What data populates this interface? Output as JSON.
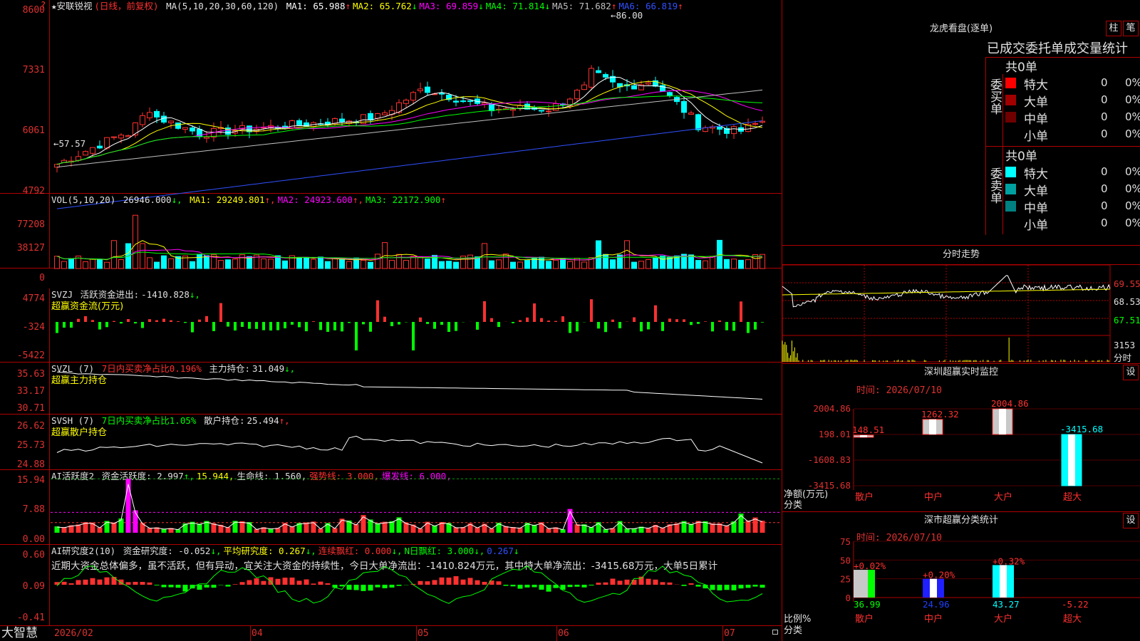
{
  "kline": {
    "star_icon": "star-icon",
    "stock_name": "★安联锐视",
    "period": "(日线，前复权)",
    "ma_label": "MA(5,10,20,30,60,120)",
    "ma": [
      {
        "label": "MA1:",
        "value": "65.988",
        "arrow": "↑",
        "color": "#ffffff"
      },
      {
        "label": "MA2:",
        "value": "65.762",
        "arrow": "↓",
        "color": "#ffff00"
      },
      {
        "label": "MA3:",
        "value": "69.859",
        "arrow": "↓",
        "color": "#ff00ff"
      },
      {
        "label": "MA4:",
        "value": "71.814",
        "arrow": "↓",
        "color": "#00ff00"
      },
      {
        "label": "MA5:",
        "value": "71.682",
        "arrow": "↑",
        "color": "#c0c0c0"
      },
      {
        "label": "MA6:",
        "value": "66.819",
        "arrow": "↑",
        "color": "#3050ff"
      }
    ],
    "y_labels": [
      "8600",
      "7331",
      "6061",
      "4792"
    ],
    "high_label": "86.00",
    "low_label": "57.57"
  },
  "vol": {
    "title": "VOL(5,10,20)",
    "value": "26946.000",
    "arrow": "↓,",
    "ma": [
      {
        "label": "MA1:",
        "value": "29249.801",
        "arrow": "↑,",
        "color": "#ffff00"
      },
      {
        "label": "MA2:",
        "value": "24923.600",
        "arrow": "↑,",
        "color": "#ff00ff"
      },
      {
        "label": "MA3:",
        "value": "22172.900",
        "arrow": "↑",
        "color": "#00ff00"
      }
    ],
    "y_labels": [
      "77208",
      "38127",
      "0"
    ]
  },
  "svzj": {
    "title": "SVZJ",
    "label": "活跃资金进出:",
    "value": "-1410.828",
    "arrow": "↓,",
    "sub": "超赢资金流(万元)",
    "y_labels": [
      "4774",
      "-324",
      "-5422"
    ]
  },
  "svzl": {
    "title": "SVZL (7)",
    "red_text": "7日内买卖净占比0.196%",
    "label": "主力持仓:",
    "value": "31.049",
    "arrow": "↓,",
    "sub": "超赢主力持仓",
    "y_labels": [
      "35.63",
      "33.17",
      "30.71"
    ]
  },
  "svsh": {
    "title": "SVSH (7)",
    "green_text": "7日内买卖净占比1.05%",
    "label": "散户持仓:",
    "value": "25.494",
    "arrow": "↑,",
    "sub": "超赢散户持仓",
    "y_labels": [
      "26.62",
      "25.73",
      "24.88"
    ]
  },
  "ai1": {
    "title": "AI活跃度2",
    "items": [
      {
        "text": "资金活跃度: 2.997",
        "arrow": "↑,",
        "color": "#e0e0e0",
        "acolor": "#00ff00"
      },
      {
        "text": "15.944,",
        "arrow": "",
        "color": "#ffff00",
        "acolor": "#ffff00"
      },
      {
        "text": "生命线: 1.560,",
        "arrow": "",
        "color": "#e0e0e0",
        "acolor": "#e0e0e0"
      },
      {
        "text": "强势线: 3.000,",
        "arrow": "",
        "color": "#ff3030",
        "acolor": "#ff3030"
      },
      {
        "text": "爆发线: 6.000,",
        "arrow": "",
        "color": "#ff00ff",
        "acolor": "#ff00ff"
      }
    ],
    "y_labels": [
      "15.94",
      "7.88",
      "0.00"
    ]
  },
  "ai2": {
    "title": "AI研究度2(10)",
    "items": [
      {
        "text": "资金研究度: -0.052",
        "arrow": "↓,",
        "color": "#e0e0e0"
      },
      {
        "text": "平均研究度: 0.267",
        "arrow": "↓,",
        "color": "#ffff00"
      },
      {
        "text": "连续飘红: 0.000",
        "arrow": "↓,",
        "color": "#ff3030"
      },
      {
        "text": "N日飘红: 3.000",
        "arrow": "↓,",
        "color": "#00ff00"
      },
      {
        "text": "0.267",
        "arrow": "↓",
        "color": "#3050ff"
      }
    ],
    "comment": "近期大资金总体偏多，虽不活跃，但有异动，宜关注大资金的持续性，今日大单净流出：-1410.824万元，其中特大单净流出：-3415.68万元，大单5日累计",
    "y_labels": [
      "0.60",
      "0.09",
      "-0.41"
    ]
  },
  "xaxis": {
    "labels": [
      "2026/02",
      "04",
      "05",
      "06",
      "07"
    ]
  },
  "brand": "大智慧",
  "lhb": {
    "title": "龙虎看盘(逐单)",
    "btn1": "柱",
    "btn2": "笔",
    "tab_label": "已成交委托单成交量统计",
    "buy_label": "委买单",
    "sell_label": "委卖单",
    "buy_total": "共0单",
    "sell_total": "共0单",
    "buy_rows": [
      {
        "name": "特大",
        "count": "0",
        "pct": "0%",
        "color": "#ff0000"
      },
      {
        "name": "大单",
        "count": "0",
        "pct": "0%",
        "color": "#a00000"
      },
      {
        "name": "中单",
        "count": "0",
        "pct": "0%",
        "color": "#700000"
      },
      {
        "name": "小单",
        "count": "0",
        "pct": "0%",
        "color": "#000000"
      }
    ],
    "sell_rows": [
      {
        "name": "特大",
        "count": "0",
        "pct": "0%",
        "color": "#00ffff"
      },
      {
        "name": "大单",
        "count": "0",
        "pct": "0%",
        "color": "#00a0a0"
      },
      {
        "name": "中单",
        "count": "0",
        "pct": "0%",
        "color": "#008080"
      },
      {
        "name": "小单",
        "count": "0",
        "pct": "0%",
        "color": "#000000"
      }
    ]
  },
  "intraday": {
    "title": "分时走势",
    "y_labels": [
      "69.55",
      "68.53",
      "67.51"
    ],
    "vol_label": "3153",
    "unit": "分时"
  },
  "sz_monitor": {
    "title": "深圳超赢实时监控",
    "btn": "设",
    "time": "时间: 2026/07/10",
    "y_labels": [
      "2004.86",
      "198.01",
      "-1608.83",
      "-3415.68"
    ],
    "unit1": "净额(万元)",
    "unit2": "分类",
    "categories": [
      "散户",
      "中户",
      "大户",
      "超大"
    ]
  },
  "sz_class": {
    "title": "深市超赢分类统计",
    "btn": "设",
    "time": "时间: 2026/07/10",
    "y_labels": [
      "75",
      "50",
      "25",
      "0"
    ],
    "unit1": "比例%",
    "unit2": "分类",
    "categories": [
      "散户",
      "中户",
      "大户",
      "超大"
    ]
  },
  "chart_data": [
    {
      "type": "bar",
      "title": "深圳超赢实时监控",
      "ylabel": "净额(万元)",
      "xlabel": "分类",
      "categories": [
        "散户",
        "中户",
        "大户",
        "超大"
      ],
      "values": [
        148.51,
        1262.32,
        2004.86,
        -3415.68
      ],
      "ylim": [
        -3415.68,
        2004.86
      ]
    },
    {
      "type": "bar",
      "title": "深市超赢分类统计",
      "ylabel": "比例%",
      "xlabel": "分类",
      "categories": [
        "散户",
        "中户",
        "大户",
        "超大"
      ],
      "values": [
        36.99,
        24.96,
        43.27,
        -5.22
      ],
      "change_labels": [
        "+0.02%",
        "+0.20%",
        "+0.32%",
        ""
      ],
      "ylim": [
        0,
        75
      ]
    }
  ]
}
